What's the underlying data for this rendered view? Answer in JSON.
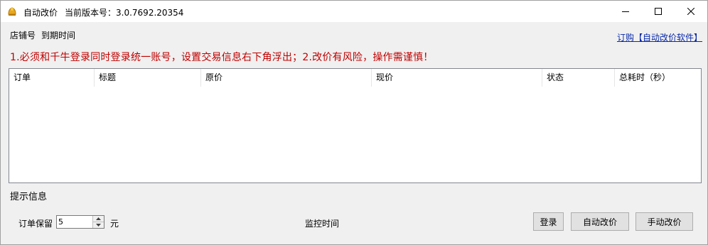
{
  "window": {
    "app_title": "自动改价",
    "version_label": "当前版本号：3.0.7692.20354",
    "icon": "app-gold-icon",
    "controls": [
      "minimize-icon",
      "maximize-icon",
      "close-icon"
    ]
  },
  "header": {
    "shop_label": "店铺号",
    "expire_label": "到期时间",
    "buy_link": "订购【自动改价软件】"
  },
  "warning": "1.必须和千牛登录同时登录统一账号，设置交易信息右下角浮出；2.改价有风险，操作需谨慎！",
  "table": {
    "columns": [
      "订单",
      "标题",
      "原价",
      "现价",
      "状态",
      "总耗时（秒）"
    ],
    "rows": []
  },
  "hint_label": "提示信息",
  "footer": {
    "keep_label": "订单保留",
    "keep_value": "5",
    "unit": "元",
    "monitor_label": "监控时间",
    "login_button": "登录",
    "auto_button": "自动改价",
    "manual_button": "手动改价"
  },
  "colors": {
    "warning": "#c00000",
    "link": "#0a2aa8",
    "background": "#f0f0f0"
  }
}
